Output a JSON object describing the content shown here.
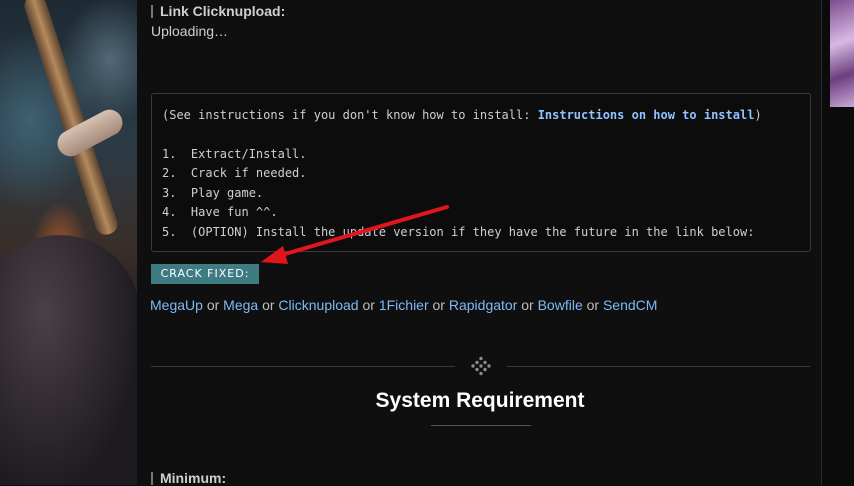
{
  "link_section": {
    "heading": "Link Clicknupload:",
    "status": "Uploading…"
  },
  "instructions": {
    "prefix": "(See instructions if you don't know how to install: ",
    "link_label": "Instructions on how to install",
    "suffix": ")",
    "steps": [
      "1.  Extract/Install.",
      "2.  Crack if needed.",
      "3.  Play game.",
      "4.  Have fun ^^.",
      "5.  (OPTION) Install the update version if they have the future in the link below:"
    ]
  },
  "crack": {
    "badge": "CRACK FIXED:",
    "links": [
      "MegaUp",
      "Mega",
      "Clicknupload",
      "1Fichier",
      "Rapidgator",
      "Bowfile",
      "SendCM"
    ],
    "separator": "or"
  },
  "system_requirement": {
    "title": "System Requirement",
    "minimum_heading": "Minimum:"
  },
  "icons": {
    "divider": "diamond-dots-icon",
    "annotation": "red-arrow"
  },
  "colors": {
    "badge": "#3f7b82",
    "link": "#7fb9f6",
    "arrow": "#e0161b"
  }
}
